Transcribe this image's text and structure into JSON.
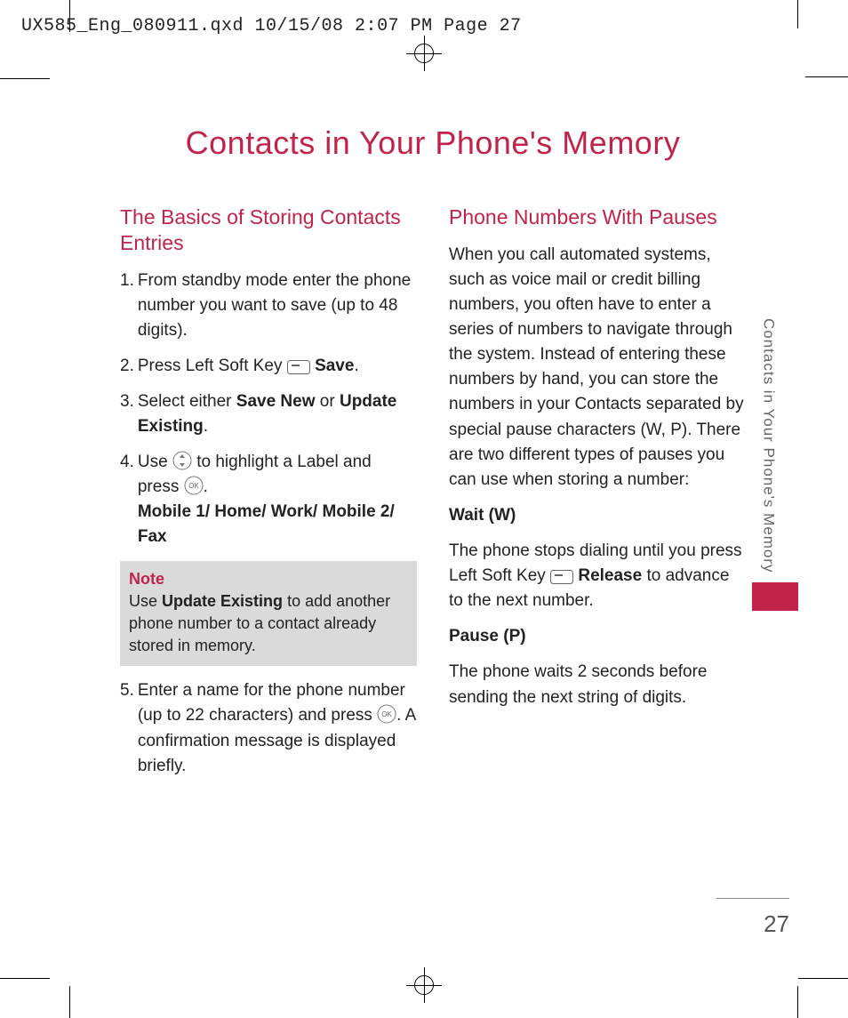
{
  "header": "UX585_Eng_080911.qxd  10/15/08  2:07 PM  Page 27",
  "title": "Contacts in Your Phone's Memory",
  "side_text": "Contacts in Your Phone's Memory",
  "page_number": "27",
  "left": {
    "section_head": "The Basics of Storing Contacts Entries",
    "steps": {
      "s1": {
        "num": "1.",
        "text": "From standby mode enter the phone number you want to save (up to 48 digits)."
      },
      "s2": {
        "num": "2.",
        "pre": "Press Left Soft Key ",
        "bold": "Save",
        "post": "."
      },
      "s3": {
        "num": "3.",
        "pre": "Select either ",
        "b1": "Save New",
        "mid": " or ",
        "b2": "Update Existing",
        "post": "."
      },
      "s4": {
        "num": "4.",
        "line1_pre": "Use ",
        "line1_post": " to highlight a Label and press ",
        "line1_end": ".",
        "line2": "Mobile 1/ Home/ Work/ Mobile 2/ Fax"
      },
      "s5": {
        "num": "5.",
        "pre": "Enter a name for the phone number (up to 22 characters) and press ",
        "post": ". A confirmation message is displayed briefly."
      }
    },
    "note": {
      "label": "Note",
      "pre": "Use ",
      "bold": "Update Existing",
      "post": " to add another phone number to a contact already stored in memory."
    }
  },
  "right": {
    "section_head": "Phone Numbers With Pauses",
    "p1": "When you call automated systems, such as voice mail or credit billing numbers, you often have to enter a series of numbers to navigate through the system. Instead of entering these numbers by hand, you can store the numbers in your Contacts separated by special pause characters (W, P). There are two different types of pauses you can use when storing a number:",
    "h_wait": "Wait (W)",
    "wait_pre": "The phone stops dialing until you press Left Soft Key ",
    "wait_bold": "Release",
    "wait_post": " to advance to the next number.",
    "h_pause": "Pause (P)",
    "pause_text": "The phone waits 2 seconds before sending the next string of digits."
  }
}
